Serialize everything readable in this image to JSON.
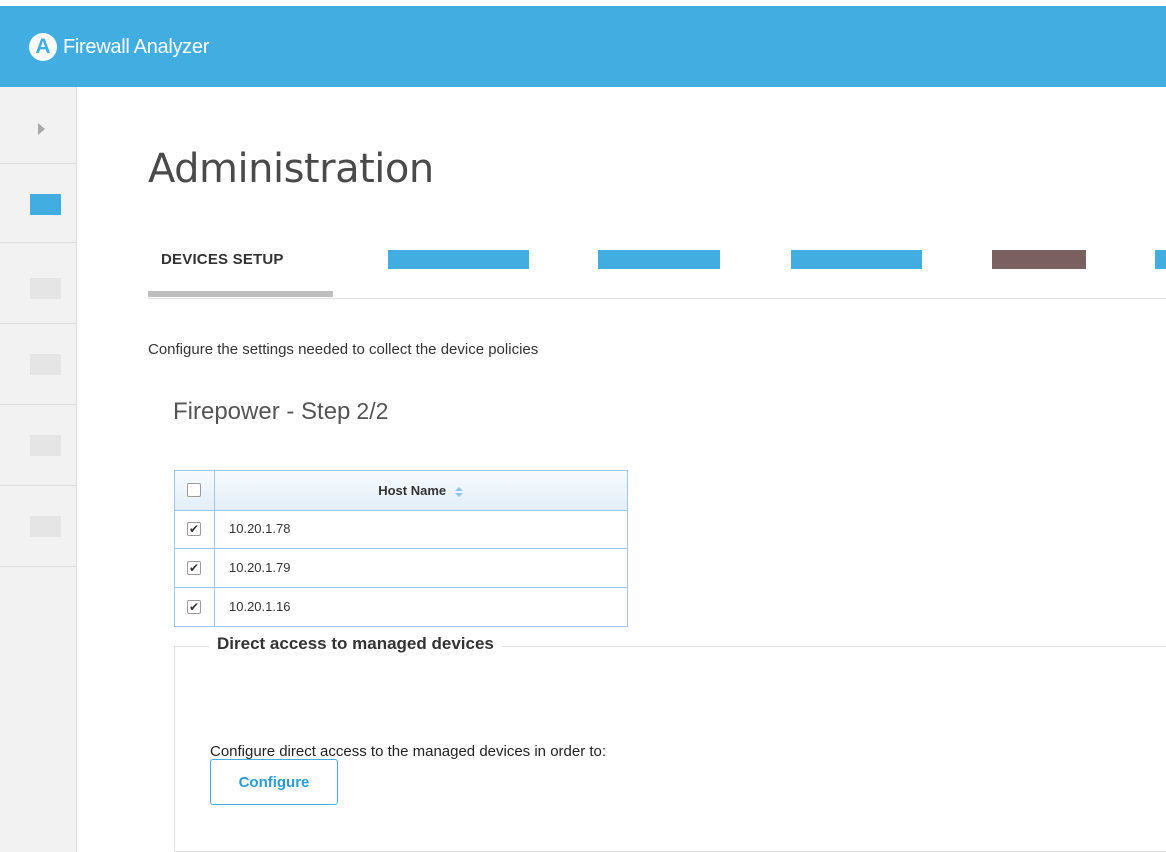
{
  "app": {
    "title": "Firewall Analyzer",
    "logo_letter": "A",
    "accent_color": "#41ade0"
  },
  "page": {
    "title": "Administration"
  },
  "tabs": {
    "active_label": "DEVICES SETUP",
    "redacted_colors": [
      "#41ade0",
      "#41ade0",
      "#41ade0",
      "#7a6060",
      "#41ade0"
    ]
  },
  "sidebar": {
    "items": [
      {
        "icon": "expand-arrow-icon"
      },
      {
        "icon": "nav-icon",
        "active": true
      },
      {
        "icon": "nav-icon",
        "active": false
      },
      {
        "icon": "nav-icon",
        "active": false
      },
      {
        "icon": "nav-icon",
        "active": false
      },
      {
        "icon": "nav-icon",
        "active": false
      }
    ]
  },
  "main": {
    "description": "Configure the settings needed to collect the device policies",
    "step_label": "Firepower - Step",
    "step_number": "2/2"
  },
  "grid": {
    "column_header": "Host Name",
    "rows": [
      {
        "host": "10.20.1.78",
        "checked": true
      },
      {
        "host": "10.20.1.79",
        "checked": true
      },
      {
        "host": "10.20.1.16",
        "checked": true
      }
    ]
  },
  "direct_access": {
    "legend": "Direct access to managed devices",
    "text": "Configure direct access to the managed devices in order to:",
    "button_label": "Configure"
  }
}
